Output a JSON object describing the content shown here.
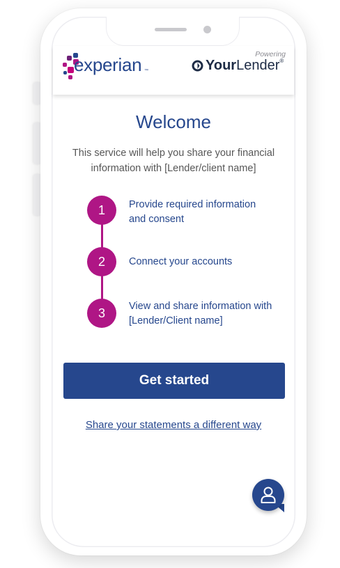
{
  "header": {
    "experian_logo_text": "experian",
    "experian_tm": "™",
    "powering_label": "Powering",
    "lender_logo_bold": "Your",
    "lender_logo_regular": "Lender",
    "lender_logo_reg": "®"
  },
  "main": {
    "title": "Welcome",
    "intro": "This service will help you share your financial information with [Lender/client name]",
    "steps": [
      {
        "number": "1",
        "text": "Provide required information and consent"
      },
      {
        "number": "2",
        "text": "Connect your accounts"
      },
      {
        "number": "3",
        "text": "View and share information with [Lender/Client name]"
      }
    ],
    "primary_button": "Get started",
    "alt_link": "Share your statements a different way"
  },
  "chat": {
    "icon": "user-icon"
  },
  "colors": {
    "brand_blue": "#26478d",
    "accent_magenta": "#af1685",
    "body_text": "#575757"
  }
}
